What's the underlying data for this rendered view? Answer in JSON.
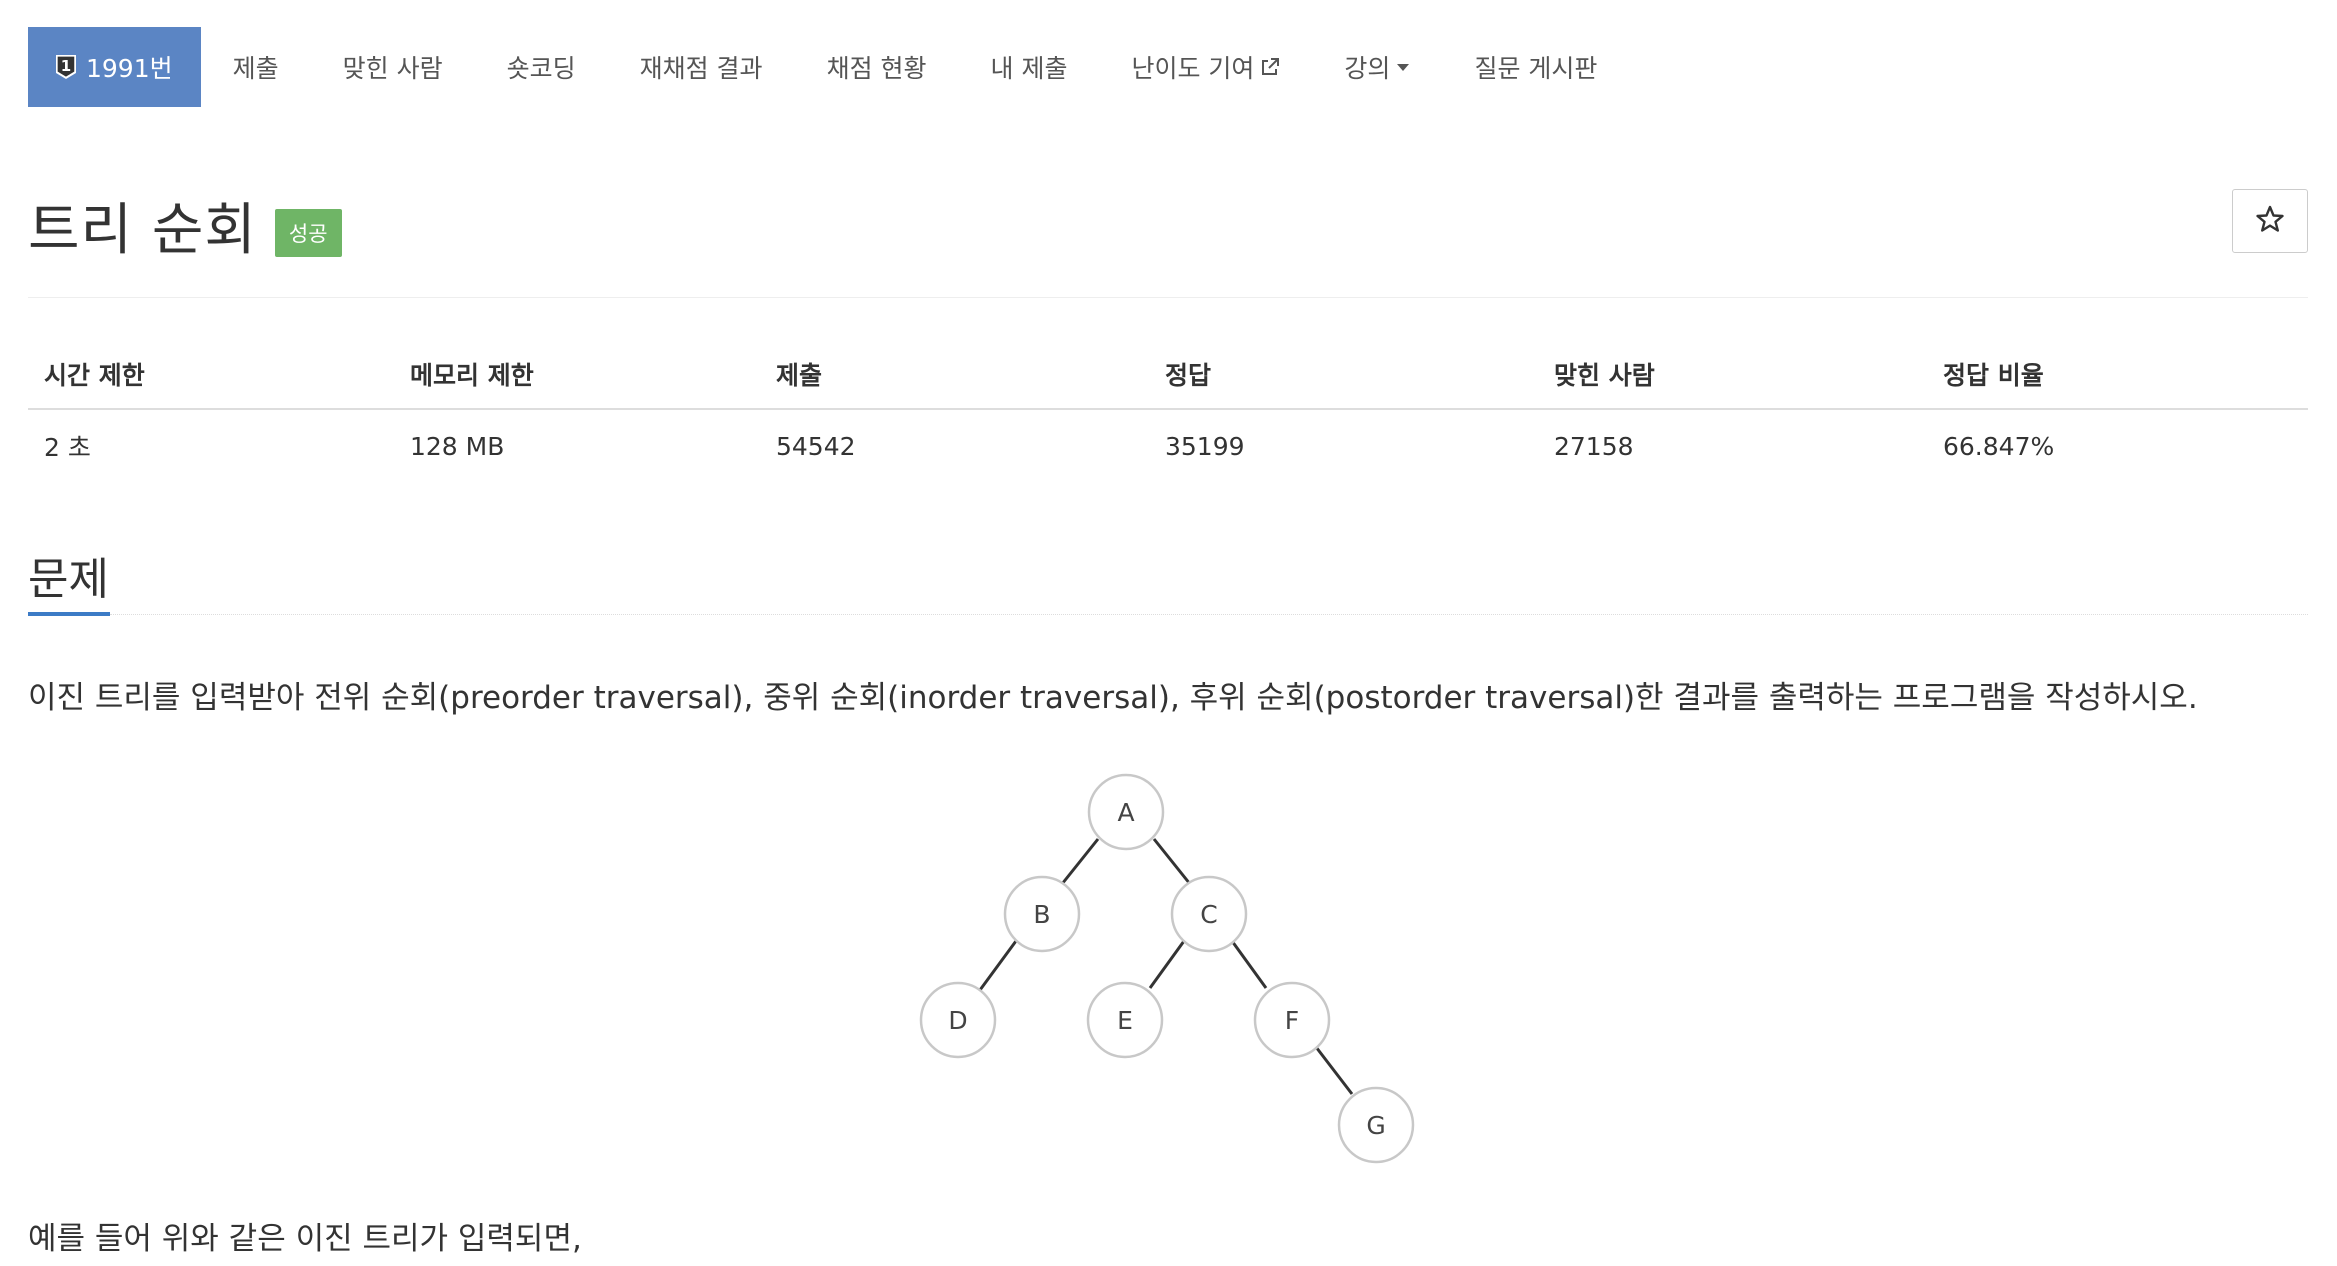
{
  "menu": {
    "problem_number": "1991번",
    "problem_number_icon": "badge-1-icon",
    "items": [
      {
        "label": "제출"
      },
      {
        "label": "맞힌 사람"
      },
      {
        "label": "숏코딩"
      },
      {
        "label": "재채점 결과"
      },
      {
        "label": "채점 현황"
      },
      {
        "label": "내 제출"
      },
      {
        "label": "난이도 기여",
        "icon": "external-link-icon"
      },
      {
        "label": "강의",
        "icon": "caret-down-icon"
      },
      {
        "label": "질문 게시판"
      }
    ]
  },
  "problem": {
    "title": "트리 순회",
    "status_badge": "성공",
    "star_icon": "star-outline-icon"
  },
  "info_table": {
    "headers": [
      "시간 제한",
      "메모리 제한",
      "제출",
      "정답",
      "맞힌 사람",
      "정답 비율"
    ],
    "values": [
      "2 초",
      "128 MB",
      "54542",
      "35199",
      "27158",
      "66.847%"
    ]
  },
  "section": {
    "heading": "문제",
    "description": "이진 트리를 입력받아 전위 순회(preorder traversal), 중위 순회(inorder traversal), 후위 순회(postorder traversal)한 결과를 출력하는 프로그램을 작성하시오.",
    "example_intro": "예를 들어 위와 같은 이진 트리가 입력되면,"
  },
  "tree_nodes": [
    "A",
    "B",
    "C",
    "D",
    "E",
    "F",
    "G"
  ],
  "colors": {
    "active_tab": "#5b85c4",
    "success_badge": "#6fb566",
    "section_accent": "#3c7bc6"
  }
}
